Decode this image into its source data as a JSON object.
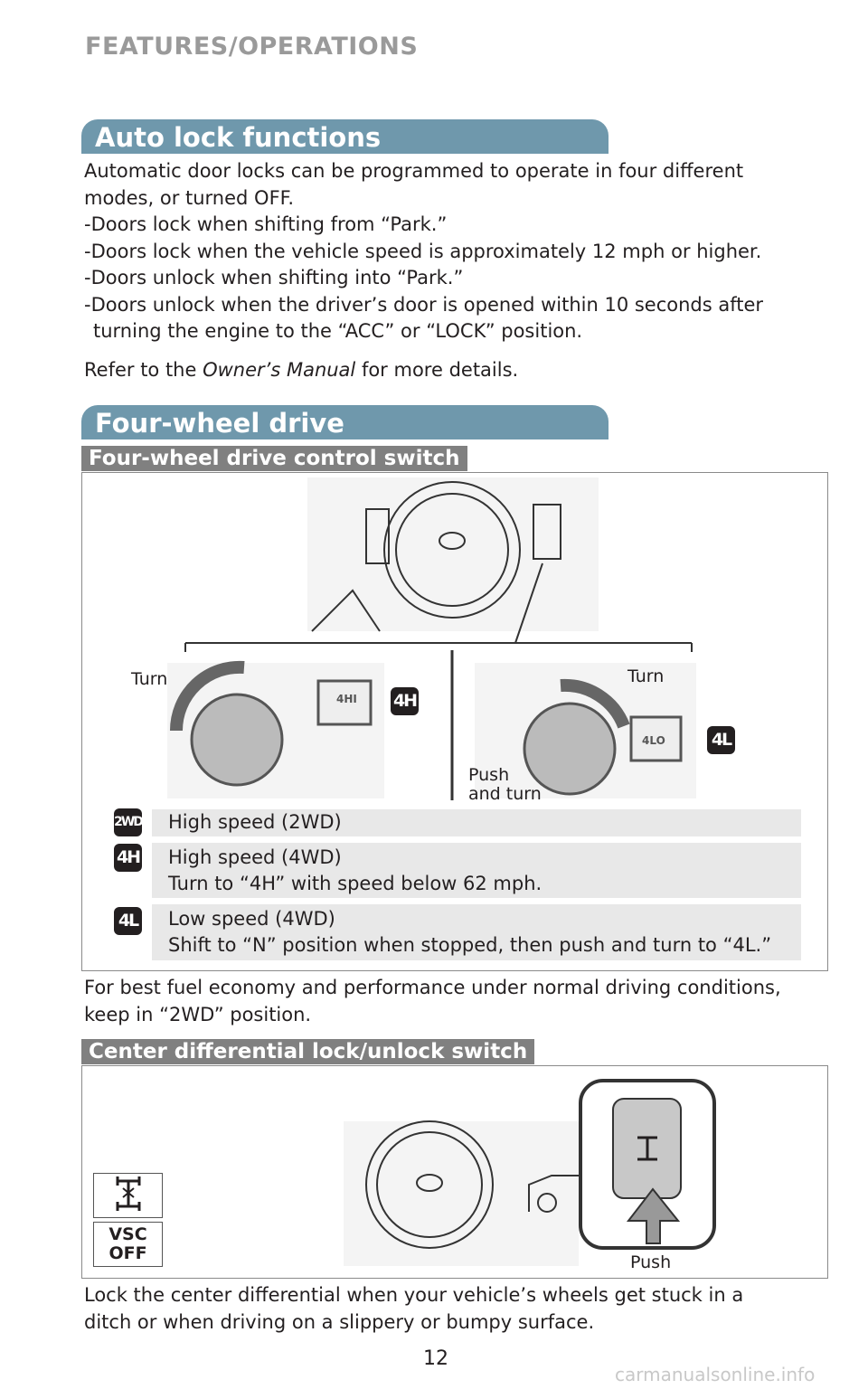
{
  "page_header": "FEATURES/OPERATIONS",
  "auto_lock": {
    "title": "Auto lock functions",
    "intro_1": "Automatic door locks can be programmed to operate in four different",
    "intro_2": "modes, or turned OFF.",
    "items": [
      "-Doors lock when shifting from “Park.”",
      "-Doors lock when the vehicle speed is approximately 12 mph or higher.",
      "-Doors unlock when shifting into “Park.”",
      "-Doors unlock when the driver’s door is opened within 10 seconds after"
    ],
    "item_4_cont": "turning the engine to the “ACC” or “LOCK” position.",
    "refer_pre": "Refer to the ",
    "refer_em": "Owner’s Manual",
    "refer_post": " for more details."
  },
  "four_wheel": {
    "title": "Four-wheel drive",
    "control_switch_title": "Four-wheel drive control switch",
    "labels": {
      "turn_left": "Turn",
      "turn_right": "Turn",
      "push": "Push",
      "and_turn": "and turn",
      "dial_4hi": "4HI",
      "dial_4lo": "4LO",
      "badge_4h": "4H",
      "badge_4l": "4L"
    },
    "modes": [
      {
        "icon": "2WD",
        "line1": "High speed (2WD)"
      },
      {
        "icon": "4H",
        "line1": "High speed (4WD)",
        "line2": "Turn to “4H” with speed below 62 mph."
      },
      {
        "icon": "4L",
        "line1": "Low speed (4WD)",
        "line2": "Shift to “N” position when stopped, then push and turn to “4L.”"
      }
    ],
    "economy_1": "For best fuel economy and performance under normal driving conditions,",
    "economy_2": "keep in “2WD” position."
  },
  "center_diff": {
    "title": "Center differential lock/unlock switch",
    "vsc_1": "VSC",
    "vsc_2": "OFF",
    "push": "Push",
    "desc_1": "Lock the center differential when your vehicle’s wheels get stuck in a",
    "desc_2": "ditch or when driving on a slippery or bumpy surface."
  },
  "page_number": "12",
  "watermark": "carmanualsonline.info",
  "colors": {
    "section_bar": "#6f98ac",
    "sub_bar": "#808080",
    "row_bg": "#e8e8e8"
  }
}
